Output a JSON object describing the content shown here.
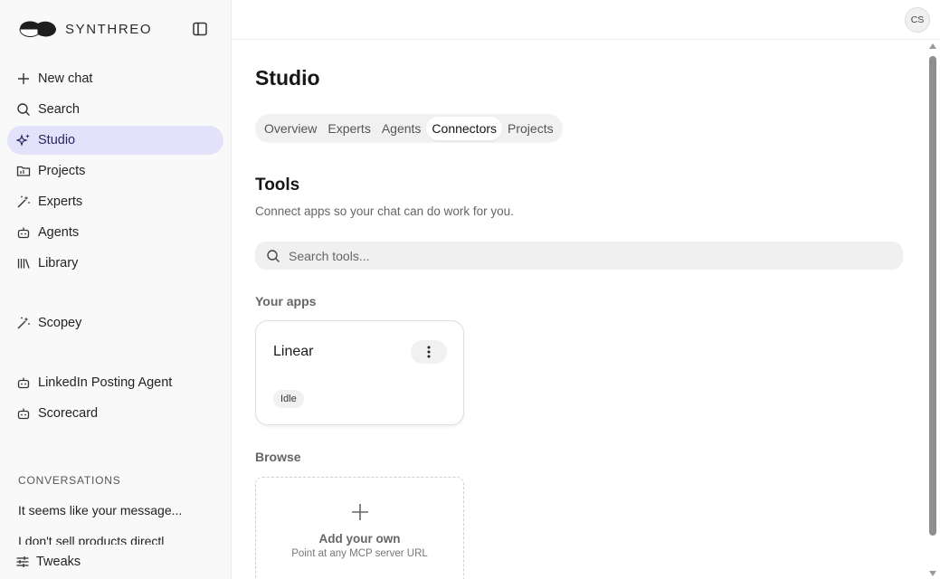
{
  "brand": {
    "name": "SYNTHREO",
    "logo_icon": "synthreo-logo-icon"
  },
  "sidebar": {
    "collapse_icon": "sidebar-toggle-icon",
    "items": [
      {
        "label": "New chat",
        "icon": "plus-icon",
        "active": false
      },
      {
        "label": "Search",
        "icon": "search-icon",
        "active": false
      },
      {
        "label": "Studio",
        "icon": "sparkles-icon",
        "active": true
      },
      {
        "label": "Projects",
        "icon": "folder-icon",
        "active": false
      },
      {
        "label": "Experts",
        "icon": "wand-icon",
        "active": false
      },
      {
        "label": "Agents",
        "icon": "bot-icon",
        "active": false
      },
      {
        "label": "Library",
        "icon": "library-icon",
        "active": false
      }
    ],
    "experts": [
      {
        "label": "Scopey",
        "icon": "wand-icon"
      }
    ],
    "agents": [
      {
        "label": "LinkedIn Posting Agent",
        "icon": "bot-icon"
      },
      {
        "label": "Scorecard",
        "icon": "bot-icon"
      }
    ],
    "conversations_label": "CONVERSATIONS",
    "conversations": [
      "It seems like your message...",
      "I don't sell products directl"
    ],
    "tweaks_label": "Tweaks"
  },
  "header": {
    "avatar_initials": "CS"
  },
  "main": {
    "title": "Studio",
    "tabs": [
      {
        "label": "Overview",
        "active": false
      },
      {
        "label": "Experts",
        "active": false
      },
      {
        "label": "Agents",
        "active": false
      },
      {
        "label": "Connectors",
        "active": true
      },
      {
        "label": "Projects",
        "active": false
      }
    ],
    "section_title": "Tools",
    "section_subtitle": "Connect apps so your chat can do work for you.",
    "search_placeholder": "Search tools...",
    "your_apps_label": "Your apps",
    "apps": [
      {
        "name": "Linear",
        "status": "Idle"
      }
    ],
    "browse_label": "Browse",
    "add_card": {
      "title": "Add your own",
      "subtitle": "Point at any MCP server URL"
    }
  },
  "colors": {
    "active_nav_bg": "#e3e2fb",
    "active_nav_text": "#2a2760"
  }
}
